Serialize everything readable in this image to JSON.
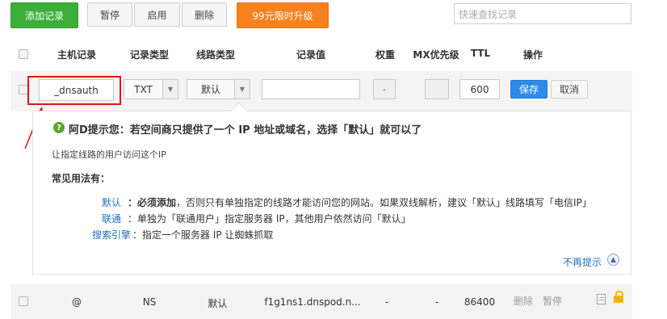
{
  "toolbar": {
    "add_label": "添加记录",
    "pause_label": "暂停",
    "enable_label": "启用",
    "delete_label": "删除",
    "upgrade_label": "99元限时升级",
    "search_placeholder": "快速查找记录"
  },
  "table": {
    "headers": [
      "主机记录",
      "记录类型",
      "线路类型",
      "记录值",
      "权重",
      "MX优先级",
      "TTL",
      "操作"
    ]
  },
  "edit_row": {
    "host_value": "_dnsauth",
    "type_value": "TXT",
    "line_value": "默认",
    "record_value": "",
    "weight_value": "-",
    "mx_value": "",
    "ttl_value": "600",
    "save_label": "保存",
    "cancel_label": "取消"
  },
  "tip": {
    "title": "阿D提示您：若空间商只提供了一个 IP 地址或域名，选择「默认」就可以了",
    "subtitle": "让指定线路的用户访问这个IP",
    "usage_heading": "常见用法有：",
    "items": [
      {
        "name": "默认",
        "desc_bold": "：必须添加",
        "desc": "，否则只有单独指定的线路才能访问您的网站。如果双线解析，建议「默认」线路填写「电信IP」"
      },
      {
        "name": "联通",
        "desc_bold": "",
        "desc": "：单独为「联通用户」指定服务器 IP，其他用户依然访问「默认」"
      },
      {
        "name": "搜索引擎",
        "desc_bold": "",
        "desc": "：指定一个服务器 IP 让蜘蛛抓取"
      }
    ],
    "dismiss_label": "不再提示"
  },
  "records": [
    {
      "host": "@",
      "type": "NS",
      "line": "默认",
      "value": "f1g1ns1.dnspod.n...",
      "weight": "-",
      "mx": "-",
      "ttl": "86400",
      "action_delete": "删除",
      "action_pause": "暂停"
    }
  ],
  "colors": {
    "accent_green": "#3cae3a",
    "accent_orange": "#f7801f",
    "accent_blue": "#2e8ce8",
    "highlight_red": "#e0151b"
  }
}
